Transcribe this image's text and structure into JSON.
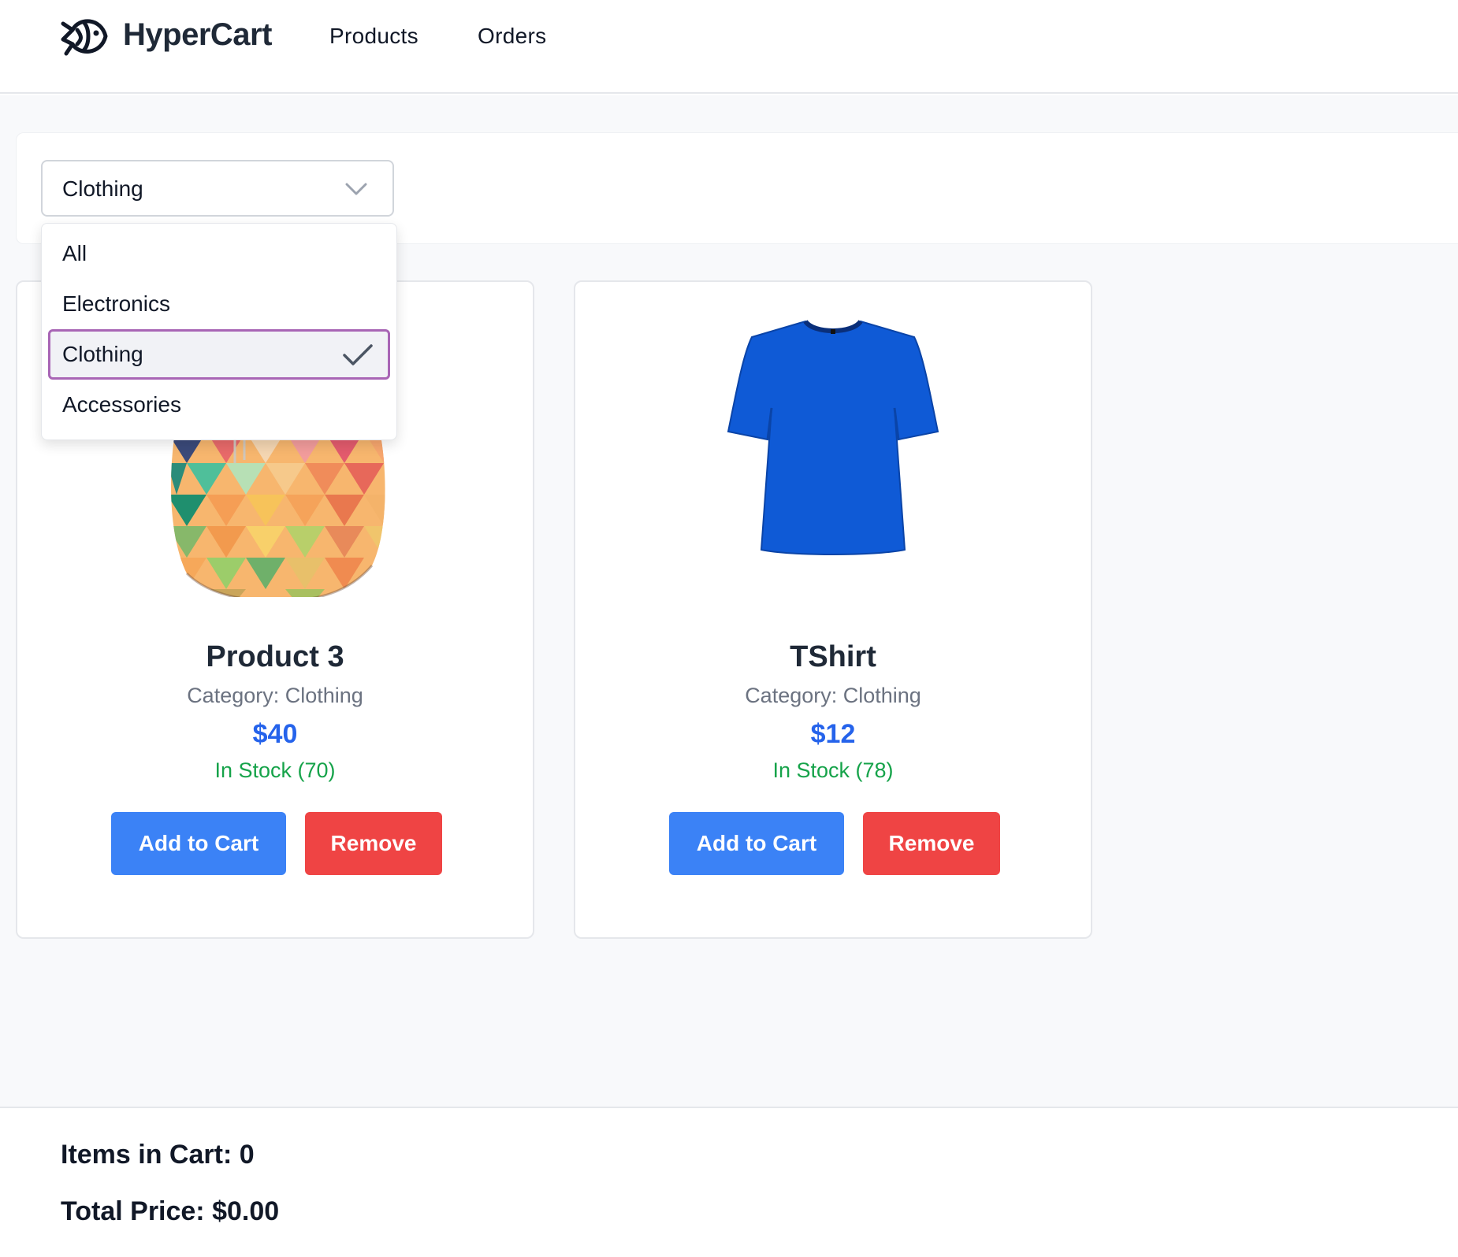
{
  "header": {
    "brand": "HyperCart",
    "nav": {
      "products": "Products",
      "orders": "Orders"
    }
  },
  "filter": {
    "selected": "Clothing",
    "options": [
      "All",
      "Electronics",
      "Clothing",
      "Accessories"
    ]
  },
  "products": [
    {
      "name": "Product 3",
      "category": "Category: Clothing",
      "price": "$40",
      "stock": "In Stock (70)",
      "add_label": "Add to Cart",
      "remove_label": "Remove",
      "image_icon": "multicolor-hoodie-image"
    },
    {
      "name": "TShirt",
      "category": "Category: Clothing",
      "price": "$12",
      "stock": "In Stock (78)",
      "add_label": "Add to Cart",
      "remove_label": "Remove",
      "image_icon": "blue-tshirt-image"
    }
  ],
  "footer": {
    "items": "Items in Cart: 0",
    "total": "Total Price: $0.00"
  },
  "colors": {
    "primary": "#3b82f6",
    "danger": "#ef4444",
    "price": "#2563eb",
    "stock": "#16a34a",
    "selected_outline": "#a865b5"
  }
}
